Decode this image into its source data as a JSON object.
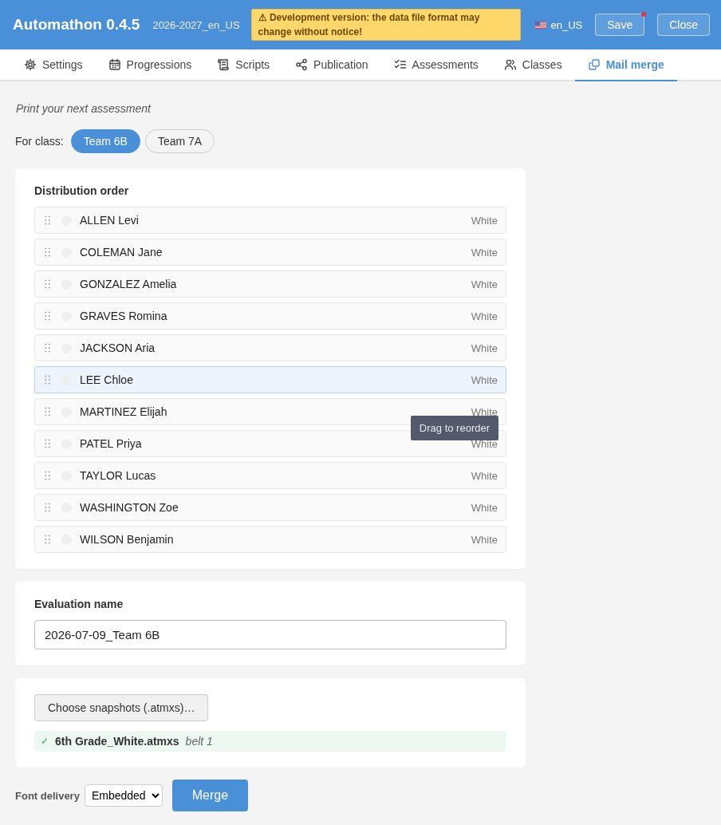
{
  "header": {
    "app_title": "Automathon 0.4.5",
    "dataset": "2026-2027_en_US",
    "warning": "⚠ Development version: the data file format may change without notice!",
    "locale": "en_US",
    "buttons": [
      {
        "label": "Save",
        "unsaved": true
      },
      {
        "label": "Close",
        "unsaved": false
      }
    ]
  },
  "tabs": [
    {
      "label": "Settings",
      "selected": false
    },
    {
      "label": "Progressions",
      "selected": false
    },
    {
      "label": "Scripts",
      "selected": false
    },
    {
      "label": "Publication",
      "selected": false
    },
    {
      "label": "Assessments",
      "selected": false
    },
    {
      "label": "Classes",
      "selected": false
    },
    {
      "label": "Mail merge",
      "selected": true
    }
  ],
  "intro": "Print your next assessment",
  "class_picker": {
    "label": "For class:",
    "options": [
      {
        "label": "Team 6B",
        "selected": true
      },
      {
        "label": "Team 7A",
        "selected": false
      }
    ]
  },
  "distribution": {
    "title": "Distribution order",
    "students": [
      {
        "name": "ALLEN Levi",
        "belt": "White",
        "selected": false
      },
      {
        "name": "COLEMAN Jane",
        "belt": "White",
        "selected": false
      },
      {
        "name": "GONZALEZ Amelia",
        "belt": "White",
        "selected": false
      },
      {
        "name": "GRAVES Romina",
        "belt": "White",
        "selected": false
      },
      {
        "name": "JACKSON Aria",
        "belt": "White",
        "selected": false
      },
      {
        "name": "LEE Chloe",
        "belt": "White",
        "selected": true
      },
      {
        "name": "MARTINEZ Elijah",
        "belt": "White",
        "selected": false,
        "tooltip": "Drag to reorder"
      },
      {
        "name": "PATEL Priya",
        "belt": "White",
        "selected": false
      },
      {
        "name": "TAYLOR Lucas",
        "belt": "White",
        "selected": false
      },
      {
        "name": "WASHINGTON Zoe",
        "belt": "White",
        "selected": false
      },
      {
        "name": "WILSON Benjamin",
        "belt": "White",
        "selected": false
      }
    ]
  },
  "evaluation": {
    "label": "Evaluation name",
    "value": "2026-07-09_Team 6B"
  },
  "snapshots": {
    "button": "Choose snapshots (.atmxs)…",
    "files": [
      {
        "check": "✓",
        "name": "6th Grade_White.atmxs",
        "note": "belt 1"
      }
    ]
  },
  "footer": {
    "label": "Font delivery",
    "select": "Embedded",
    "button": "Merge"
  }
}
